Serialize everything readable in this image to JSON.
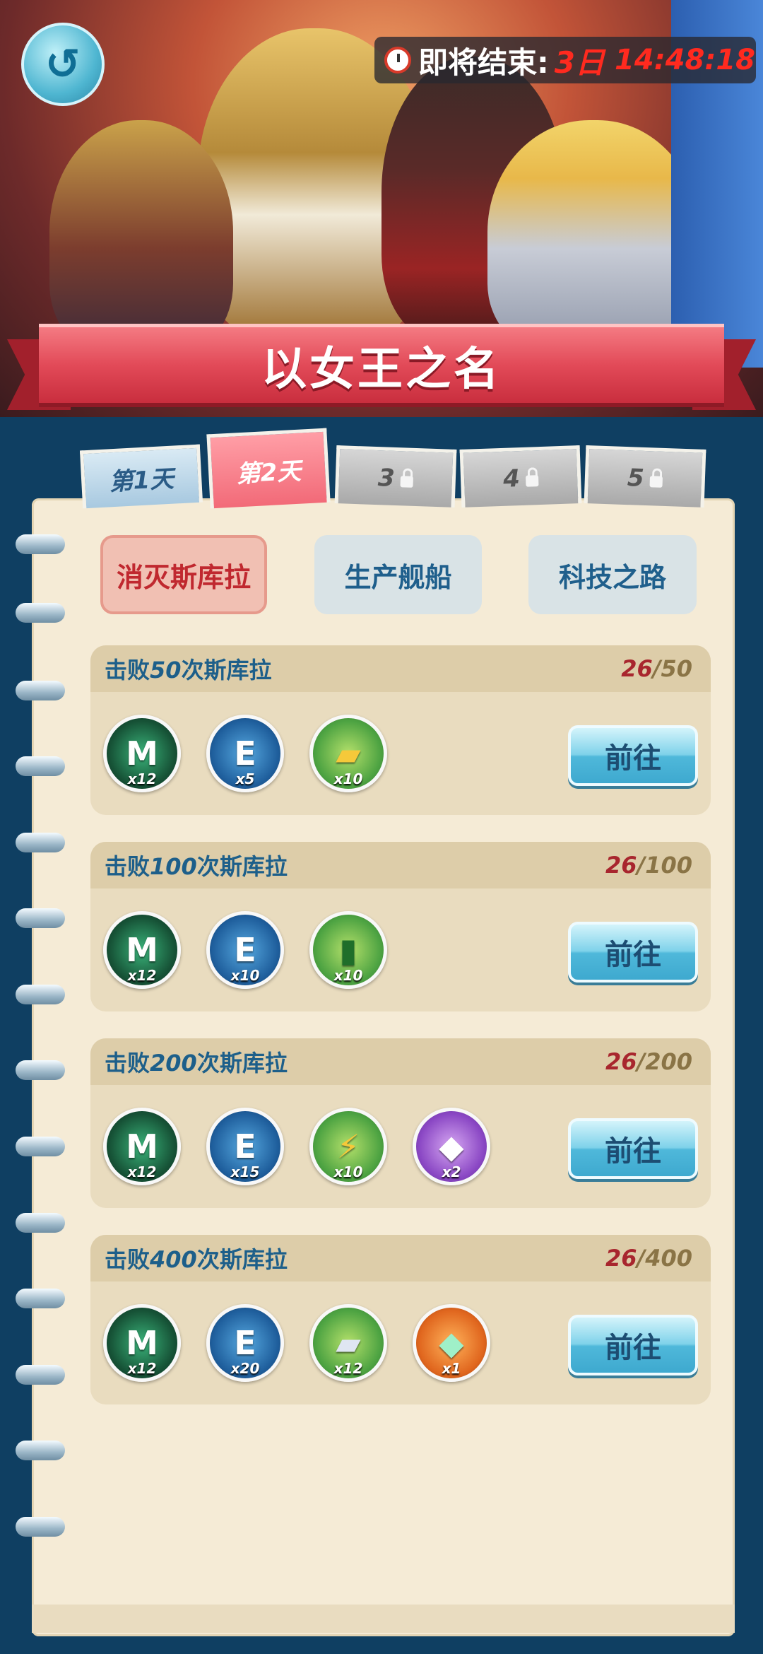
{
  "header": {
    "timer_label": "即将结束:",
    "timer_days": "3日",
    "timer_time": "14:48:18",
    "event_title": "以女王之名",
    "back_icon": "back-arrow-icon"
  },
  "day_tabs": [
    {
      "label": "第1天",
      "state": "unlocked"
    },
    {
      "label": "第2天",
      "state": "selected"
    },
    {
      "label": "3",
      "state": "locked"
    },
    {
      "label": "4",
      "state": "locked"
    },
    {
      "label": "5",
      "state": "locked"
    }
  ],
  "categories": [
    {
      "label": "消灭斯库拉",
      "selected": true
    },
    {
      "label": "生产舰船",
      "selected": false
    },
    {
      "label": "科技之路",
      "selected": false
    }
  ],
  "tasks": [
    {
      "prefix": "击败",
      "count": "50",
      "suffix": "次斯库拉",
      "progress_current": "26",
      "progress_max": "/50",
      "go_label": "前往",
      "rewards": [
        {
          "icon": "medal-icon",
          "qty": "x12"
        },
        {
          "icon": "exp-book-icon",
          "qty": "x5"
        },
        {
          "icon": "gold-bars-icon",
          "qty": "x10"
        }
      ]
    },
    {
      "prefix": "击败",
      "count": "100",
      "suffix": "次斯库拉",
      "progress_current": "26",
      "progress_max": "/100",
      "go_label": "前往",
      "rewards": [
        {
          "icon": "medal-icon",
          "qty": "x12"
        },
        {
          "icon": "exp-book-icon",
          "qty": "x10"
        },
        {
          "icon": "oil-barrel-icon",
          "qty": "x10"
        }
      ]
    },
    {
      "prefix": "击败",
      "count": "200",
      "suffix": "次斯库拉",
      "progress_current": "26",
      "progress_max": "/200",
      "go_label": "前往",
      "rewards": [
        {
          "icon": "medal-icon",
          "qty": "x12"
        },
        {
          "icon": "exp-book-icon",
          "qty": "x15"
        },
        {
          "icon": "power-cell-icon",
          "qty": "x10"
        },
        {
          "icon": "purple-capsule-icon",
          "qty": "x2"
        }
      ]
    },
    {
      "prefix": "击败",
      "count": "400",
      "suffix": "次斯库拉",
      "progress_current": "26",
      "progress_max": "/400",
      "go_label": "前往",
      "rewards": [
        {
          "icon": "medal-icon",
          "qty": "x12"
        },
        {
          "icon": "exp-book-icon",
          "qty": "x20"
        },
        {
          "icon": "steel-ingots-icon",
          "qty": "x12"
        },
        {
          "icon": "green-capsule-icon",
          "qty": "x1"
        }
      ]
    }
  ],
  "colors": {
    "accent_red": "#ff2a1f",
    "title_blue": "#1d5f8a",
    "paper": "#f5ebd6"
  }
}
